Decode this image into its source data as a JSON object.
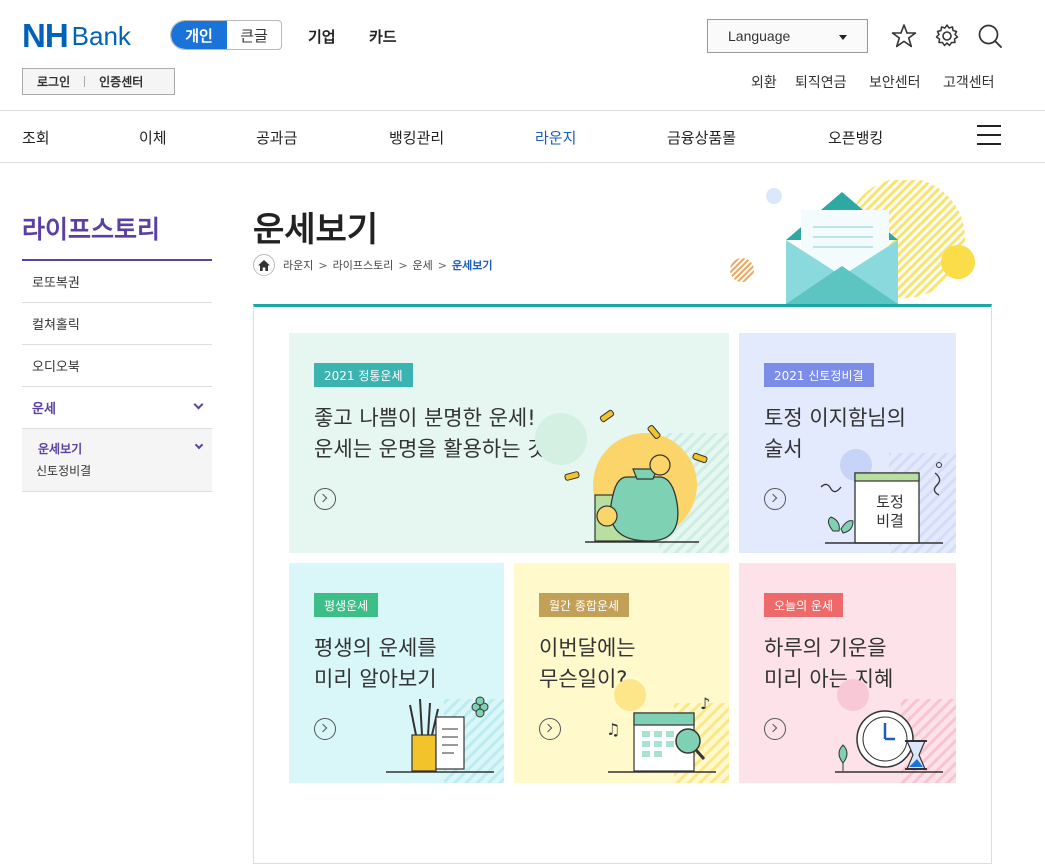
{
  "header": {
    "logo_nh": "NH",
    "logo_bank": "Bank",
    "mode_personal": "개인",
    "mode_bigtext": "큰글",
    "nav_corp": "기업",
    "nav_card": "카드",
    "login": "로그인",
    "cert": "인증센터",
    "language": "Language",
    "utils": [
      "외환",
      "퇴직연금",
      "보안센터",
      "고객센터"
    ]
  },
  "gnb": [
    "조회",
    "이체",
    "공과금",
    "뱅킹관리",
    "라운지",
    "금융상품몰",
    "오픈뱅킹"
  ],
  "lnb": {
    "title": "라이프스토리",
    "items": [
      "로또복권",
      "컬쳐홀릭",
      "오디오북",
      "운세"
    ],
    "sub": [
      "운세보기",
      "신토정비결"
    ]
  },
  "page": {
    "title": "운세보기",
    "breadcrumb": [
      "라운지",
      "라이프스토리",
      "운세",
      "운세보기"
    ]
  },
  "cards": [
    {
      "badge": "2021 정통운세",
      "text": "좋고 나쁨이 분명한 운세!\n운세는 운명을 활용하는 것",
      "badge_color": "#3bb3b0",
      "bg": "#e6f6f0"
    },
    {
      "badge": "2021 신토정비결",
      "text": "토정 이지함님의\n술서",
      "badge_color": "#7b8de8",
      "bg": "#e3eafd",
      "book_label": "토정\n비결"
    },
    {
      "badge": "평생운세",
      "text": "평생의 운세를\n미리 알아보기",
      "badge_color": "#3bbf86",
      "bg": "#d9f7f9"
    },
    {
      "badge": "월간 종합운세",
      "text": "이번달에는\n무슨일이?",
      "badge_color": "#c2a058",
      "bg": "#fff9cc"
    },
    {
      "badge": "오늘의 운세",
      "text": "하루의 기운을\n미리 아는 지혜",
      "badge_color": "#ee6a6a",
      "bg": "#fde2ea"
    }
  ],
  "colors": {
    "brand": "#0062b8",
    "accent": "#5b3fa3",
    "teal": "#1ba7a4"
  }
}
